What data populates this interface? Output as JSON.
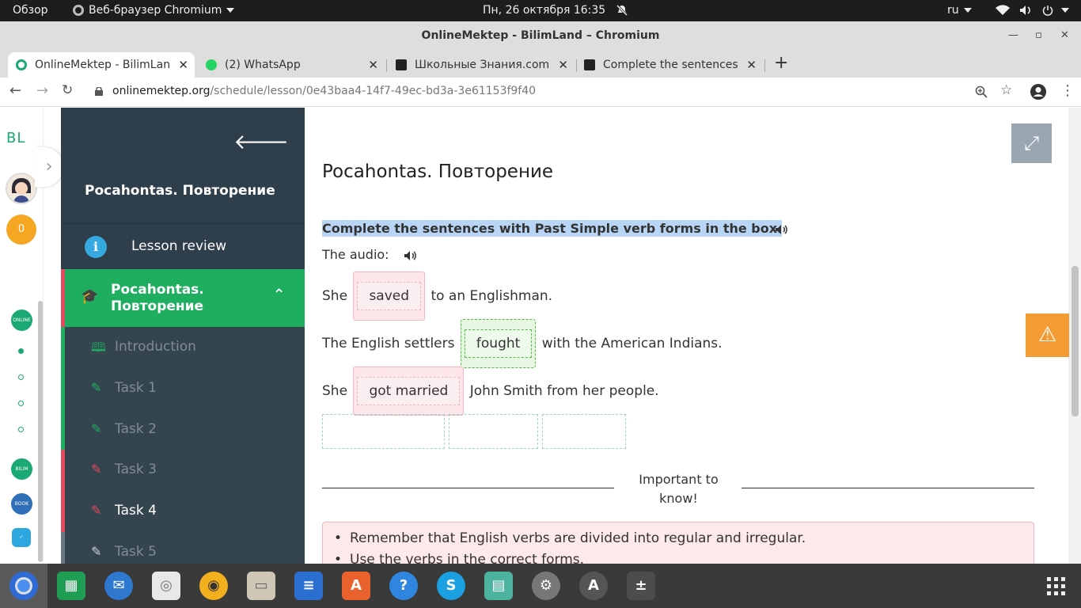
{
  "system": {
    "overview": "Обзор",
    "browser_menu": "Веб-браузер Chromium",
    "datetime": "Пн, 26 октября  16:35",
    "lang": "ru"
  },
  "window": {
    "title": "OnlineMektep - BilimLand – Chromium"
  },
  "tabs": [
    {
      "label": "OnlineMektep - BilimLand",
      "favicon_color": "#1aa874"
    },
    {
      "label": "(2) WhatsApp",
      "favicon_color": "#25d366"
    },
    {
      "label": "Школьные Знания.com -",
      "favicon_color": "#222222"
    },
    {
      "label": "Complete the sentences v",
      "favicon_color": "#222222"
    }
  ],
  "address": {
    "host": "onlinemektep.org",
    "path": "/schedule/lesson/0e43baa4-14f7-49ec-bd3a-3e61153f9f40"
  },
  "rail": {
    "logo": "BL",
    "coins": "0"
  },
  "sidebar": {
    "title": "Pocahontas. Повторение",
    "review": "Lesson review",
    "active_line1": "Pocahontas.",
    "active_line2": "Повторение",
    "items": [
      {
        "label": "Introduction",
        "icon": "book-icon",
        "mark": "#1fae60"
      },
      {
        "label": "Task 1",
        "icon": "edit-icon",
        "mark": "#1fae60"
      },
      {
        "label": "Task 2",
        "icon": "edit-icon",
        "mark": "#1fae60"
      },
      {
        "label": "Task 3",
        "icon": "edit-icon",
        "mark": "#e34a5c"
      },
      {
        "label": "Task 4",
        "icon": "edit-icon",
        "mark": "#e34a5c"
      },
      {
        "label": "Task 5",
        "icon": "edit-icon",
        "mark": "#6a7880"
      }
    ]
  },
  "main": {
    "title": "Pocahontas. Повторение",
    "instruction": "Complete the sentences with Past Simple verb forms in the box.",
    "audio_label": "The audio:",
    "s1": {
      "before": "She",
      "answer": "saved",
      "after": "to an Englishman."
    },
    "s2": {
      "before": "The English settlers",
      "answer": "fought",
      "after": "with the American Indians."
    },
    "s3": {
      "before": "She",
      "answer": "got married",
      "after": "John Smith from her people."
    },
    "important_line1": "Important to",
    "important_line2": "know!",
    "notes": [
      "Remember that English verbs are divided into regular and irregular.",
      "Use the verbs in the correct forms."
    ]
  },
  "colors": {
    "sidebar_bg": "#2f3e4b",
    "accent_green": "#1fae60",
    "accent_red": "#e34a5c",
    "warning": "#f39c34"
  }
}
